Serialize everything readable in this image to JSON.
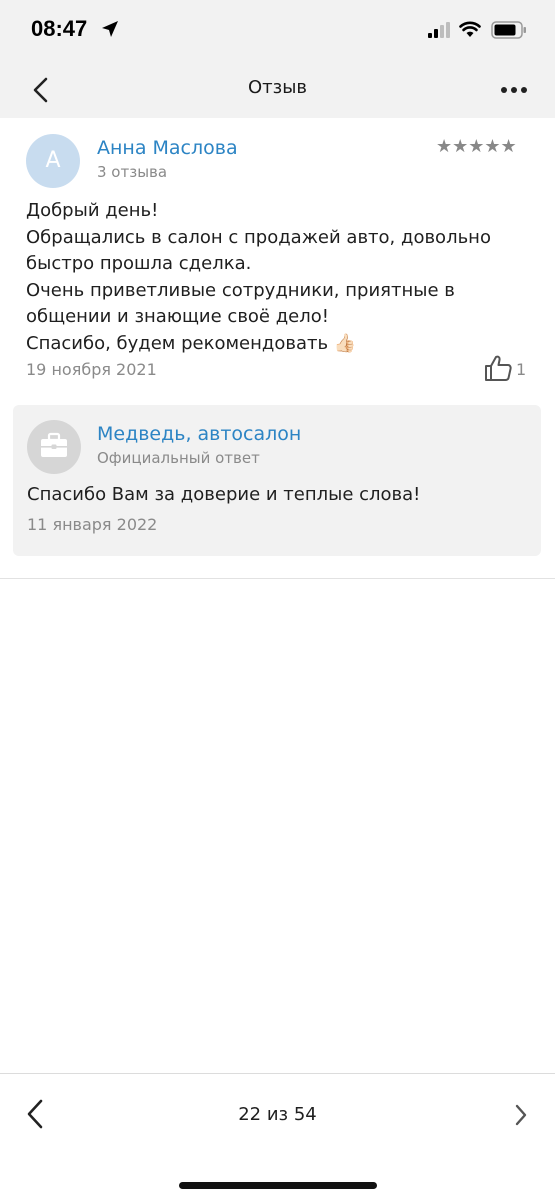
{
  "status_bar": {
    "time": "08:47"
  },
  "nav": {
    "title": "Отзыв"
  },
  "review": {
    "avatar_letter": "А",
    "author": "Анна Маслова",
    "author_reviews": "3 отзыва",
    "rating": 5,
    "rating_stars": "★★★★★",
    "text_lines": [
      "Добрый день!",
      "Обращались в салон с продажей авто, довольно",
      "быстро прошла сделка.",
      "Очень приветливые сотрудники, приятные в",
      "общении и знающие своё дело!",
      "Спасибо, будем рекомендовать 👍🏻"
    ],
    "date": "19 ноября 2021",
    "likes": "1"
  },
  "reply": {
    "author": "Медведь, автосалон",
    "subtitle": "Официальный ответ",
    "text": "Спасибо Вам за доверие и теплые слова!",
    "date": "11 января 2022"
  },
  "pager": {
    "text": "22 из 54"
  },
  "colors": {
    "link": "#2c84c4",
    "muted": "#8a8a8a",
    "bar_bg": "#f2f2f2",
    "avatar_bg": "#c8dcef"
  }
}
